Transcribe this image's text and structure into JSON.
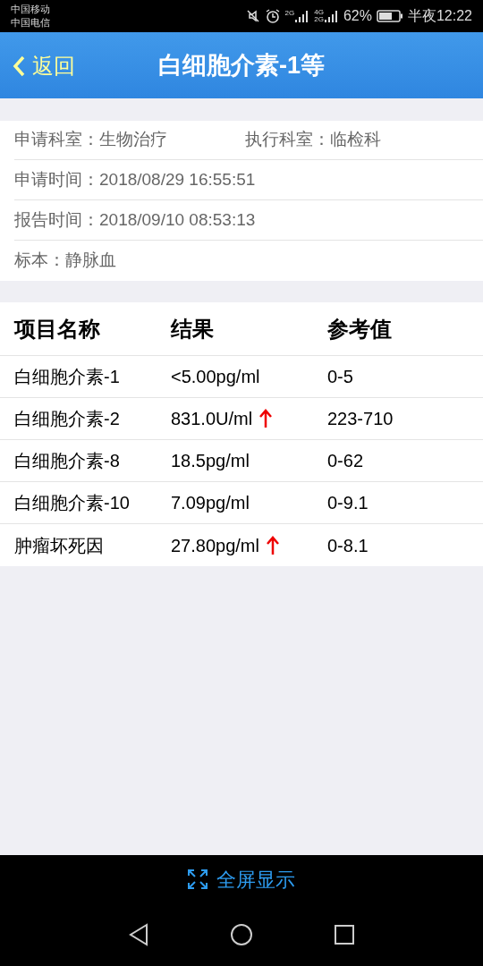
{
  "status_bar": {
    "carriers": [
      "中国移动",
      "中国电信"
    ],
    "network_1": "2G",
    "network_2": [
      "4G",
      "2G"
    ],
    "battery_percent": "62%",
    "time": "半夜12:22"
  },
  "header": {
    "back": "返回",
    "title": "白细胞介素-1等"
  },
  "info": {
    "apply_dept": "申请科室：生物治疗",
    "exec_dept": "执行科室：临检科",
    "rows": [
      "申请时间：2018/08/29 16:55:51",
      "报告时间：2018/09/10 08:53:13",
      "标本：静脉血"
    ]
  },
  "table": {
    "columns": [
      "项目名称",
      "结果",
      "参考值"
    ],
    "rows": [
      {
        "name": "白细胞介素-1",
        "result": "<5.00pg/ml",
        "high": false,
        "reference": "0-5"
      },
      {
        "name": "白细胞介素-2",
        "result": "831.0U/ml",
        "high": true,
        "reference": "223-710"
      },
      {
        "name": "白细胞介素-8",
        "result": "18.5pg/ml",
        "high": false,
        "reference": "0-62"
      },
      {
        "name": "白细胞介素-10",
        "result": "7.09pg/ml",
        "high": false,
        "reference": "0-9.1"
      },
      {
        "name": "肿瘤坏死因",
        "result": "27.80pg/ml",
        "high": true,
        "reference": "0-8.1"
      }
    ]
  },
  "bottom_button": "全屏显示"
}
